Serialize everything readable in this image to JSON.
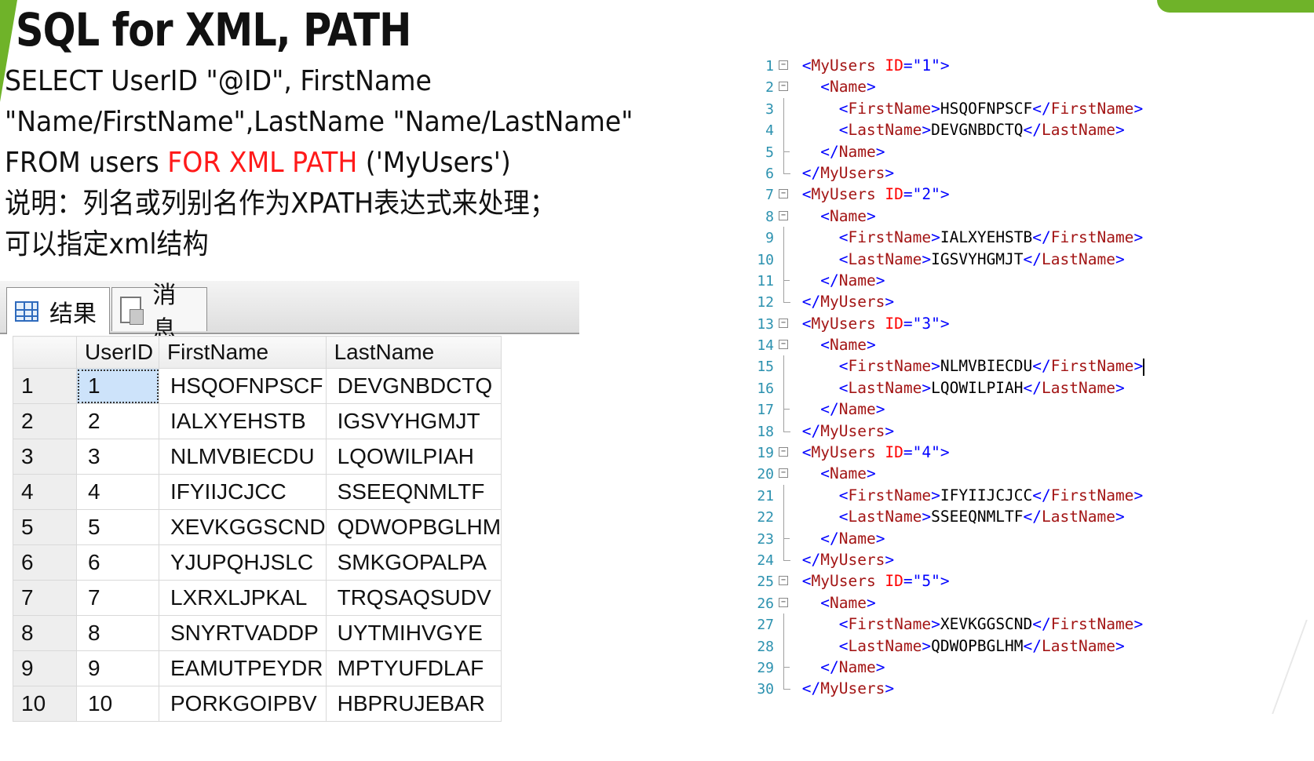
{
  "slide": {
    "title": "SQL for XML, PATH",
    "line1": "SELECT  UserID  \"@ID\",  FirstName",
    "line2": "\"Name/FirstName\",LastName  \"Name/LastName\"",
    "line3_pre": "FROM  users  ",
    "line3_kw": "FOR  XML  PATH",
    "line3_post": "  ('MyUsers')",
    "line4": "说明：列名或列别名作为XPATH表达式来处理；",
    "line5": "可以指定xml结构"
  },
  "results_pane": {
    "tabs": [
      {
        "label": "结果",
        "icon": "grid-icon"
      },
      {
        "label": "消息",
        "icon": "message-icon"
      }
    ],
    "columns": [
      "UserID",
      "FirstName",
      "LastName"
    ],
    "rows": [
      {
        "rn": "1",
        "id": "1",
        "first": "HSQOFNPSCF",
        "last": "DEVGNBDCTQ"
      },
      {
        "rn": "2",
        "id": "2",
        "first": "IALXYEHSTB",
        "last": "IGSVYHGMJT"
      },
      {
        "rn": "3",
        "id": "3",
        "first": "NLMVBIECDU",
        "last": "LQOWILPIAH"
      },
      {
        "rn": "4",
        "id": "4",
        "first": "IFYIIJCJCC",
        "last": "SSEEQNMLTF"
      },
      {
        "rn": "5",
        "id": "5",
        "first": "XEVKGGSCND",
        "last": "QDWOPBGLHM"
      },
      {
        "rn": "6",
        "id": "6",
        "first": "YJUPQHJSLC",
        "last": "SMKGOPALPA"
      },
      {
        "rn": "7",
        "id": "7",
        "first": "LXRXLJPKAL",
        "last": "TRQSAQSUDV"
      },
      {
        "rn": "8",
        "id": "8",
        "first": "SNYRTVADDP",
        "last": "UYTMIHVGYE"
      },
      {
        "rn": "9",
        "id": "9",
        "first": "EAMUTPEYDR",
        "last": "MPTYUFDLAF"
      },
      {
        "rn": "10",
        "id": "10",
        "first": "PORKGOIPBV",
        "last": "HBPRUJEBAR"
      }
    ]
  },
  "xml_editor": {
    "records": [
      {
        "id": "1",
        "first": "HSQOFNPSCF",
        "last": "DEVGNBDCTQ"
      },
      {
        "id": "2",
        "first": "IALXYEHSTB",
        "last": "IGSVYHGMJT"
      },
      {
        "id": "3",
        "first": "NLMVBIECDU",
        "last": "LQOWILPIAH"
      },
      {
        "id": "4",
        "first": "IFYIIJCJCC",
        "last": "SSEEQNMLTF"
      },
      {
        "id": "5",
        "first": "XEVKGGSCND",
        "last": "QDWOPBGLHM"
      }
    ]
  },
  "colors": {
    "accent_green": "#6fb329",
    "keyword_red": "#ff1a1a",
    "xml_tag": "#a31515",
    "xml_bracket": "#0000ff",
    "xml_attr": "#ff0000",
    "line_number": "#2b91af"
  }
}
